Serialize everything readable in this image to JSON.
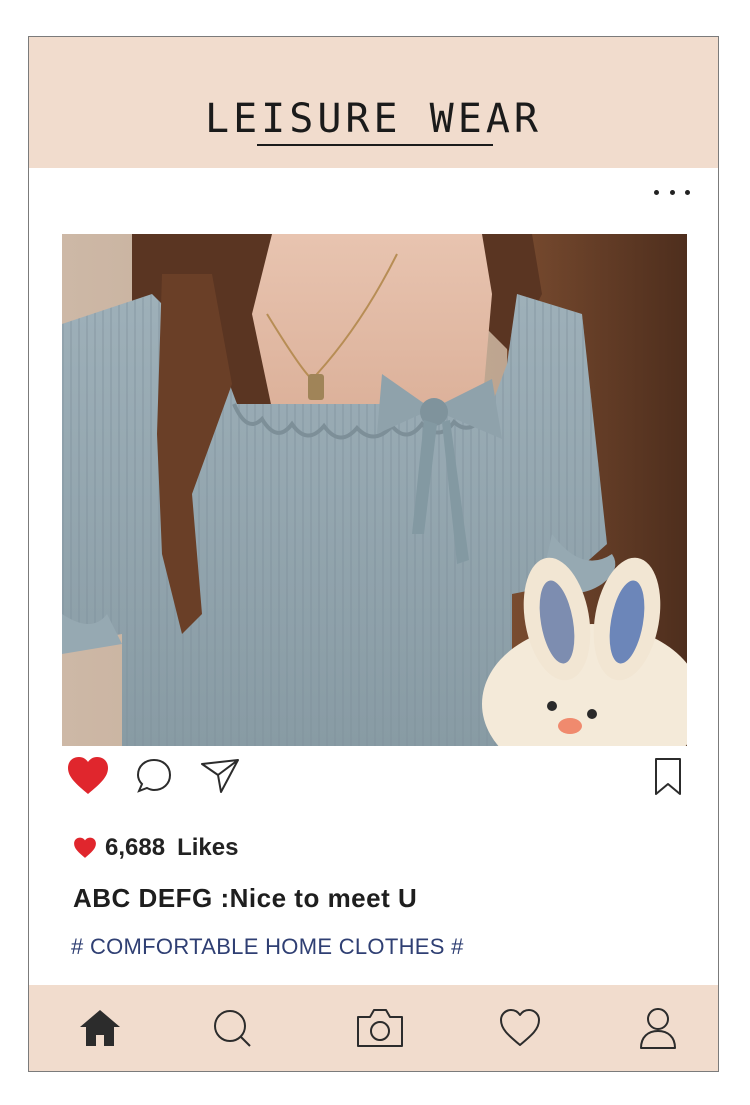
{
  "header": {
    "title": "LEISURE WEAR"
  },
  "post": {
    "menu_icon": "more-dots-icon",
    "photo_alt": "Photo of a blue ruffled top with bow, necklace, and plush bunny",
    "liked": true,
    "likes_count": "6,688",
    "likes_label": "Likes",
    "caption": "ABC DEFG :Nice to meet U",
    "hashtag": "# COMFORTABLE HOME CLOTHES #"
  },
  "actions": [
    "heart-icon",
    "comment-icon",
    "share-icon",
    "bookmark-icon"
  ],
  "nav": [
    "home-icon",
    "search-icon",
    "camera-icon",
    "heart-icon",
    "profile-icon"
  ],
  "colors": {
    "accent_bg": "#f1dccd",
    "like_red": "#e0262d",
    "hashtag_blue": "#2f3f73",
    "icon_dark": "#2c2c2c"
  }
}
